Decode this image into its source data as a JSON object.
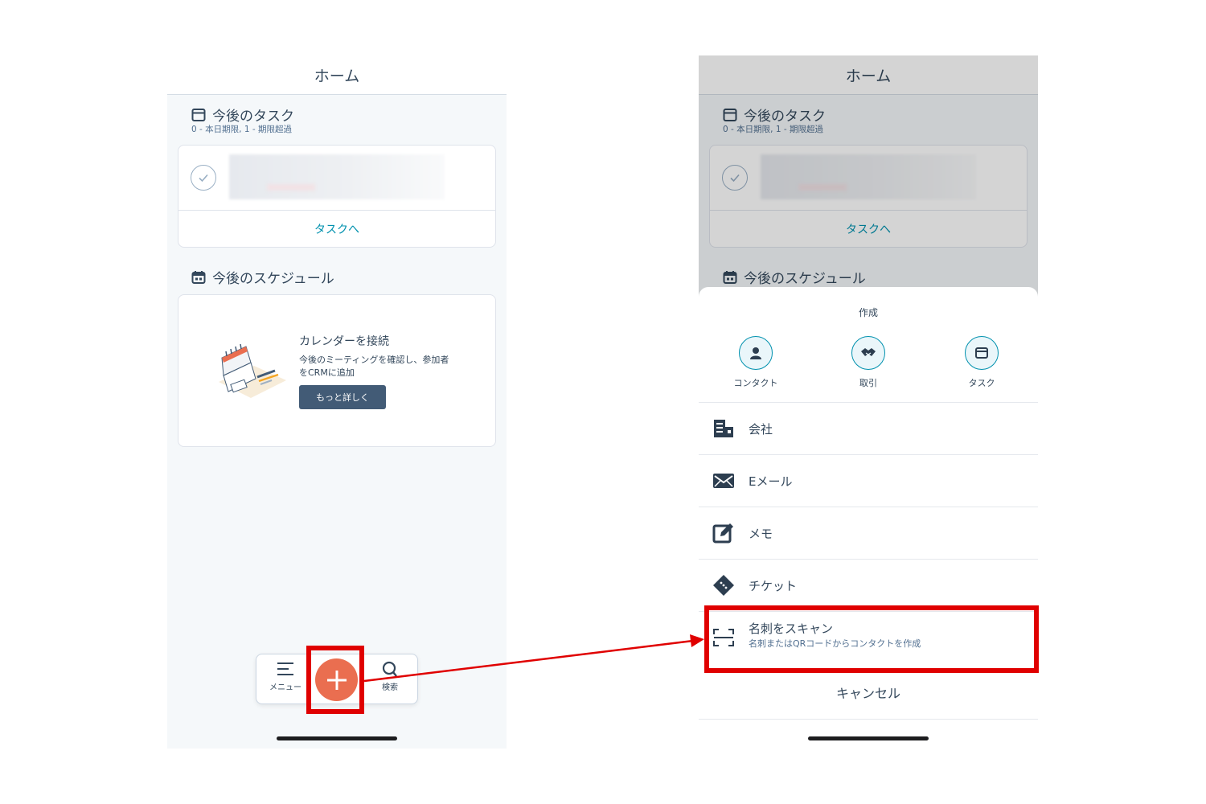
{
  "left": {
    "header_title": "ホーム",
    "tasks_title": "今後のタスク",
    "tasks_subtitle": "0 - 本日期限, 1 - 期限超過",
    "tasks_link": "タスクへ",
    "schedule_title": "今後のスケジュール",
    "calendar": {
      "title": "カレンダーを接続",
      "description": "今後のミーティングを確認し、参加者をCRMに追加",
      "button": "もっと詳しく"
    },
    "nav": {
      "menu_label": "メニュー",
      "search_label": "検索"
    }
  },
  "right": {
    "header_title": "ホーム",
    "tasks_title": "今後のタスク",
    "tasks_subtitle": "0 - 本日期限, 1 - 期限超過",
    "tasks_link": "タスクへ",
    "schedule_title": "今後のスケジュール",
    "sheet": {
      "title": "作成",
      "create_items": [
        {
          "label": "コンタクト",
          "icon": "person-icon"
        },
        {
          "label": "取引",
          "icon": "handshake-icon"
        },
        {
          "label": "タスク",
          "icon": "task-icon"
        }
      ],
      "rows": [
        {
          "label": "会社",
          "icon": "building-icon"
        },
        {
          "label": "Eメール",
          "icon": "envelope-icon"
        },
        {
          "label": "メモ",
          "icon": "pencil-note-icon"
        },
        {
          "label": "チケット",
          "icon": "ticket-icon"
        },
        {
          "label": "名刺をスキャン",
          "sublabel": "名刺またはQRコードからコンタクトを作成",
          "icon": "scan-icon"
        }
      ],
      "cancel": "キャンセル"
    }
  },
  "colors": {
    "fab": "#ea6e50",
    "accent_link": "#0091ae",
    "highlight": "#e00000",
    "text": "#33475b",
    "button_dark": "#425b76"
  }
}
